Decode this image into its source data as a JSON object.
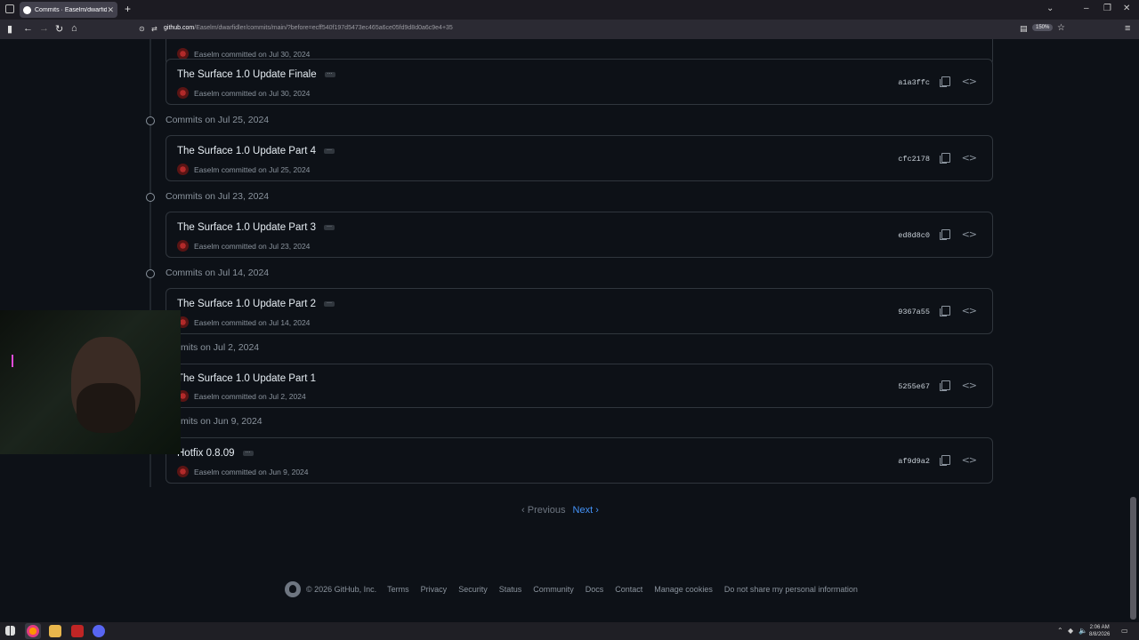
{
  "browser": {
    "tab_title": "Commits · Easelm/dwarfidler",
    "url_domain": "github.com",
    "url_path": "/Easelm/dwarfidler/commits/main/?before=ecff540f197d5473ec465a6ce05fd9d8d0a6c9e4+35",
    "zoom": "150%"
  },
  "groups": [
    {
      "heading": "Commits on Jul 25, 2024"
    },
    {
      "heading": "Commits on Jul 23, 2024"
    },
    {
      "heading": "Commits on Jul 14, 2024"
    },
    {
      "heading": "mits on Jul 2, 2024"
    },
    {
      "heading": "mits on Jun 9, 2024"
    }
  ],
  "commits": [
    {
      "title": "",
      "meta": "Easelm committed on Jul 30, 2024",
      "sha": ""
    },
    {
      "title": "The Surface 1.0 Update Finale",
      "meta": "Easelm committed on Jul 30, 2024",
      "sha": "a1a3ffc"
    },
    {
      "title": "The Surface 1.0 Update Part 4",
      "meta": "Easelm committed on Jul 25, 2024",
      "sha": "cfc2178"
    },
    {
      "title": "The Surface 1.0 Update Part 3",
      "meta": "Easelm committed on Jul 23, 2024",
      "sha": "ed8d8c0"
    },
    {
      "title": "The Surface 1.0 Update Part 2",
      "meta": "Easelm committed on Jul 14, 2024",
      "sha": "9367a55"
    },
    {
      "title": "The Surface 1.0 Update Part 1",
      "meta": "Easelm committed on Jul 2, 2024",
      "sha": "5255e67"
    },
    {
      "title": "Hotfix 0.8.09",
      "meta": "Easelm committed on Jun 9, 2024",
      "sha": "af9d9a2"
    }
  ],
  "pagination": {
    "previous": "Previous",
    "next": "Next"
  },
  "footer": {
    "copyright": "© 2026 GitHub, Inc.",
    "links": [
      "Terms",
      "Privacy",
      "Security",
      "Status",
      "Community",
      "Docs",
      "Contact",
      "Manage cookies",
      "Do not share my personal information"
    ]
  },
  "taskbar": {
    "time": "2:06 AM",
    "date": "8/8/2026"
  },
  "icons": {
    "commit_dots": "ellipsis-icon",
    "copy": "copy-icon",
    "browse": "code-icon"
  }
}
